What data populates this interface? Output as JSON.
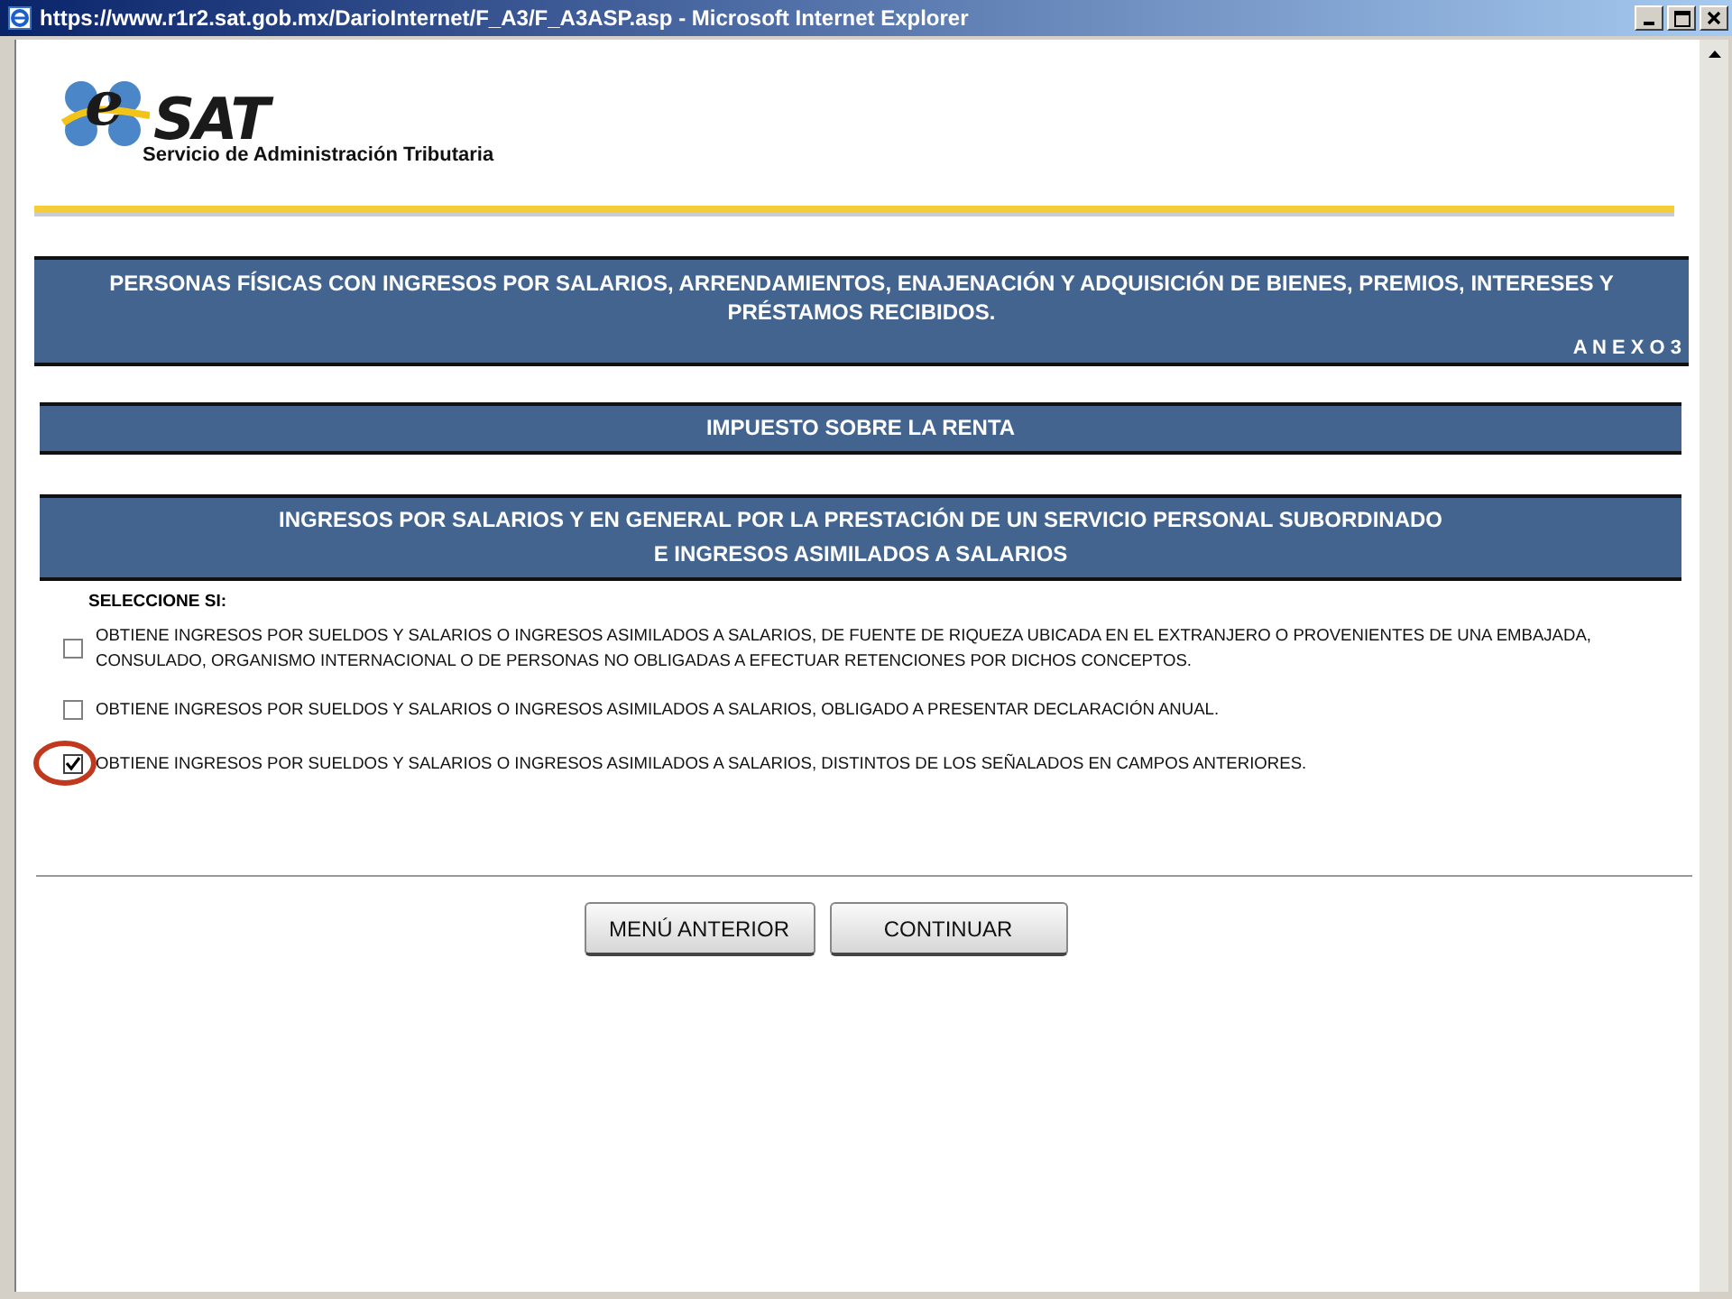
{
  "window": {
    "title": "https://www.r1r2.sat.gob.mx/DarioInternet/F_A3/F_A3ASP.asp - Microsoft Internet Explorer"
  },
  "logo": {
    "letter": "e",
    "name": "SAT",
    "subtitle": "Servicio de Administración Tributaria"
  },
  "header": {
    "title": "PERSONAS FÍSICAS CON INGRESOS POR SALARIOS, ARRENDAMIENTOS, ENAJENACIÓN Y ADQUISICIÓN DE BIENES, PREMIOS, INTERESES Y PRÉSTAMOS RECIBIDOS.",
    "annex": "A N E X O 3"
  },
  "sections": [
    {
      "lines": [
        "IMPUESTO SOBRE LA RENTA"
      ]
    },
    {
      "lines": [
        "INGRESOS POR SALARIOS Y EN GENERAL POR LA PRESTACIÓN DE UN SERVICIO PERSONAL SUBORDINADO",
        "E INGRESOS ASIMILADOS A SALARIOS"
      ]
    }
  ],
  "prompt": "SELECCIONE SI:",
  "options": [
    {
      "label": "OBTIENE INGRESOS POR SUELDOS Y SALARIOS O INGRESOS ASIMILADOS A SALARIOS, DE FUENTE DE RIQUEZA UBICADA EN EL EXTRANJERO O PROVENIENTES DE UNA EMBAJADA, CONSULADO, ORGANISMO INTERNACIONAL O DE PERSONAS NO OBLIGADAS A EFECTUAR RETENCIONES POR DICHOS CONCEPTOS.",
      "checked": false,
      "highlighted": false
    },
    {
      "label": "OBTIENE INGRESOS POR SUELDOS Y SALARIOS O INGRESOS ASIMILADOS A SALARIOS, OBLIGADO A PRESENTAR DECLARACIÓN ANUAL.",
      "checked": false,
      "highlighted": false
    },
    {
      "label": "OBTIENE INGRESOS POR SUELDOS Y SALARIOS O INGRESOS ASIMILADOS A SALARIOS, DISTINTOS DE LOS SEÑALADOS EN CAMPOS ANTERIORES.",
      "checked": true,
      "highlighted": true
    }
  ],
  "buttons": [
    "MENÚ ANTERIOR",
    "CONTINUAR"
  ]
}
